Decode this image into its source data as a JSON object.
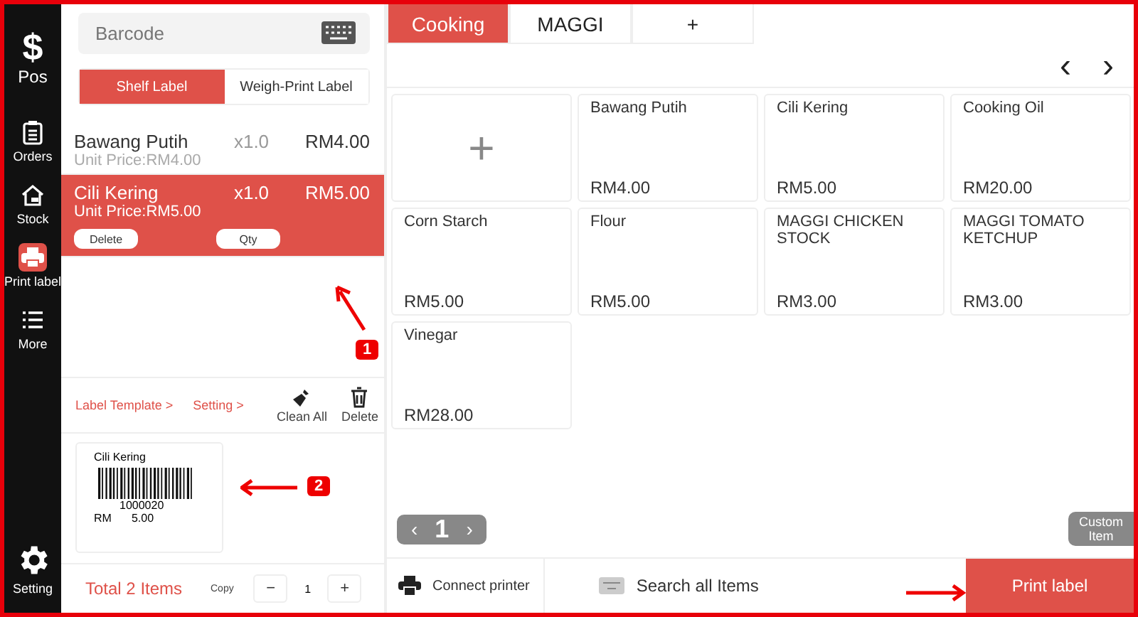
{
  "sidebar": {
    "logo": "$",
    "logo_label": "Pos",
    "items": [
      {
        "label": "Orders",
        "kind": "orders",
        "selected": false
      },
      {
        "label": "Stock",
        "kind": "stock",
        "selected": false
      },
      {
        "label": "Print label",
        "kind": "print",
        "selected": true
      },
      {
        "label": "More",
        "kind": "more",
        "selected": false
      }
    ],
    "footer": {
      "label": "Setting"
    }
  },
  "barcode": {
    "placeholder": "Barcode"
  },
  "label_types": [
    {
      "label": "Shelf Label",
      "selected": true
    },
    {
      "label": "Weigh-Print Label",
      "selected": false
    }
  ],
  "cart": [
    {
      "name": "Bawang Putih",
      "qty": "x1.0",
      "total": "RM4.00",
      "unit_price": "Unit Price:RM4.00",
      "selected": false
    },
    {
      "name": "Cili Kering",
      "qty": "x1.0",
      "total": "RM5.00",
      "unit_price": "Unit Price:RM5.00",
      "selected": true,
      "actions": [
        "Delete",
        "Qty"
      ]
    }
  ],
  "toolbar": {
    "links": [
      "Label Template >",
      "Setting >"
    ],
    "tools": [
      {
        "label": "Clean All",
        "kind": "clean"
      },
      {
        "label": "Delete",
        "kind": "delete"
      }
    ]
  },
  "label_preview": {
    "name": "Cili Kering",
    "code": "1000020",
    "currency": "RM",
    "price": "5.00"
  },
  "footer": {
    "total": "Total 2 Items",
    "copy_label": "Copy",
    "minus": "−",
    "copies": "1",
    "plus": "+"
  },
  "category_tabs": [
    {
      "label": "Cooking",
      "selected": true
    },
    {
      "label": "MAGGI",
      "selected": false
    },
    {
      "label": "+",
      "selected": false
    }
  ],
  "pager_arrows": [
    "‹",
    "›"
  ],
  "products": [
    {
      "kind": "add",
      "label": "+"
    },
    {
      "kind": "product",
      "name": "Bawang Putih",
      "price": "RM4.00"
    },
    {
      "kind": "product",
      "name": "Cili Kering",
      "price": "RM5.00"
    },
    {
      "kind": "product",
      "name": "Cooking Oil",
      "price": "RM20.00"
    },
    {
      "kind": "product",
      "name": "Corn Starch",
      "price": "RM5.00"
    },
    {
      "kind": "product",
      "name": "Flour",
      "price": "RM5.00"
    },
    {
      "kind": "product",
      "name": "MAGGI CHICKEN STOCK",
      "price": "RM3.00"
    },
    {
      "kind": "product",
      "name": "MAGGI TOMATO KETCHUP",
      "price": "RM3.00"
    },
    {
      "kind": "product",
      "name": "Vinegar",
      "price": "RM28.00"
    }
  ],
  "pagination": {
    "prev": "‹",
    "page": "1",
    "next": "›"
  },
  "custom_item": "Custom Item",
  "bottom_bar": {
    "connect": "Connect printer",
    "search": "Search all Items",
    "print": "Print label"
  },
  "annotations": [
    {
      "label": "1"
    },
    {
      "label": "2"
    }
  ]
}
